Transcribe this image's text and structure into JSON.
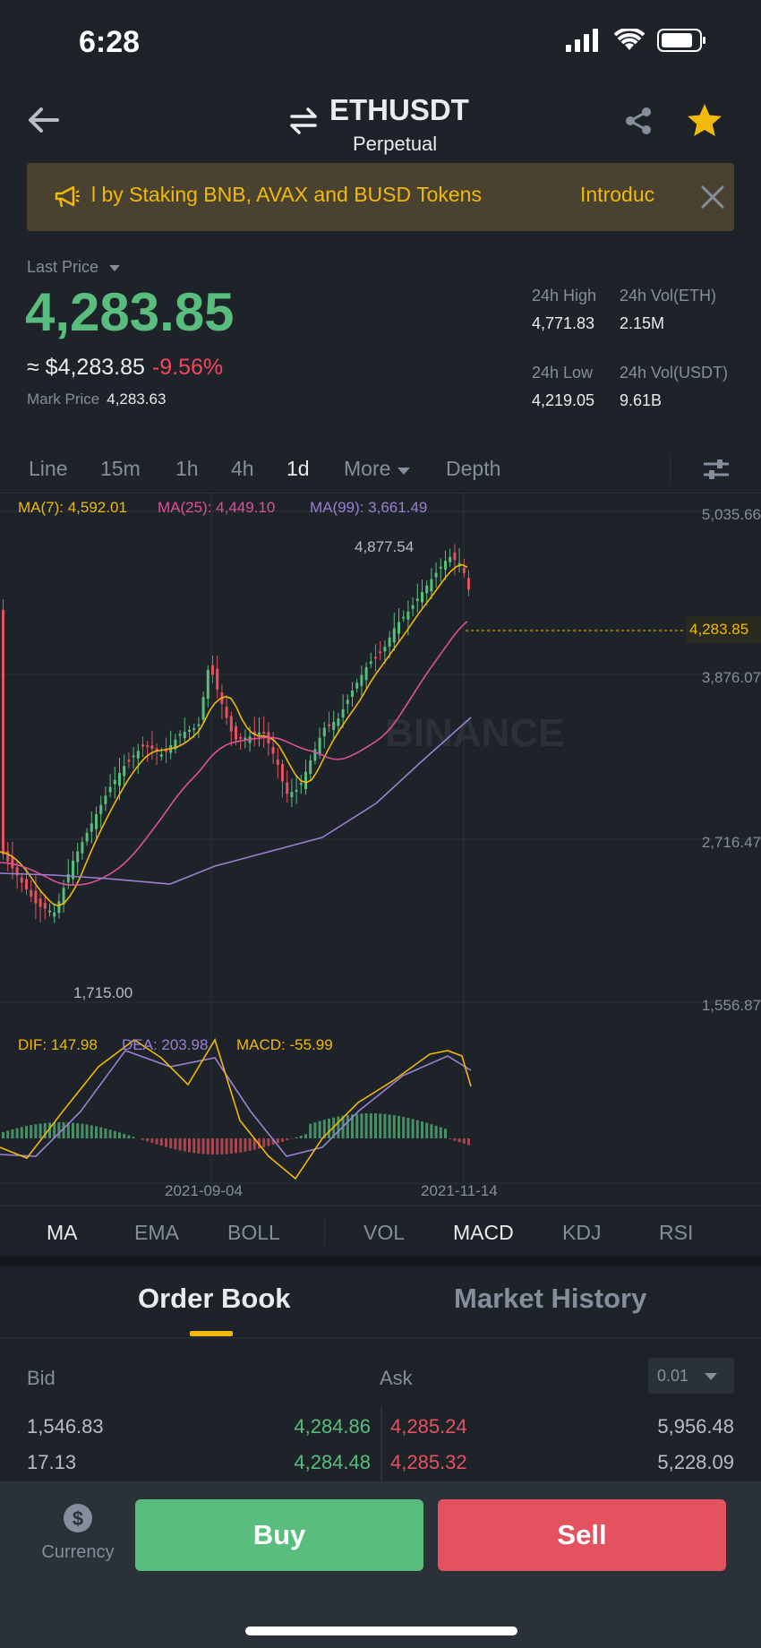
{
  "status_bar": {
    "time": "6:28"
  },
  "header": {
    "pair": "ETHUSDT",
    "contract_type": "Perpetual"
  },
  "banner": {
    "text": "l by Staking BNB, AVAX and BUSD Tokens",
    "link": "Introduc"
  },
  "ticker": {
    "last_price_label": "Last Price",
    "last_price": "4,283.85",
    "approx_usd": "≈ $4,283.85",
    "change_pct": "-9.56%",
    "mark_price_label": "Mark Price",
    "mark_price": "4,283.63",
    "high_label": "24h High",
    "high": "4,771.83",
    "vol_eth_label": "24h Vol(ETH)",
    "vol_eth": "2.15M",
    "low_label": "24h Low",
    "low": "4,219.05",
    "vol_usdt_label": "24h Vol(USDT)",
    "vol_usdt": "9.61B"
  },
  "intervals": [
    "Line",
    "15m",
    "1h",
    "4h",
    "1d",
    "More",
    "Depth"
  ],
  "active_interval": "1d",
  "chart": {
    "ma7_label": "MA(7): 4,592.01",
    "ma25_label": "MA(25): 4,449.10",
    "ma99_label": "MA(99): 3,661.49",
    "price_axis": [
      "5,035.66",
      "3,876.07",
      "2,716.47",
      "1,556.87"
    ],
    "current_price": "4,283.85",
    "high_marker": "4,877.54",
    "low_marker": "1,715.00",
    "watermark": "BINANCE",
    "dif_label": "DIF: 147.98",
    "dea_label": "DEA: 203.98",
    "macd_label": "MACD: -55.99",
    "dates": [
      "2021-09-04",
      "2021-11-14"
    ]
  },
  "indicator_tabs": [
    "MA",
    "EMA",
    "BOLL",
    "VOL",
    "MACD",
    "KDJ",
    "RSI"
  ],
  "order_book": {
    "tab_order_book": "Order Book",
    "tab_market_history": "Market History",
    "bid_label": "Bid",
    "ask_label": "Ask",
    "precision": "0.01",
    "rows": [
      {
        "bid_qty": "1,546.83",
        "bid_price": "4,284.86",
        "ask_price": "4,285.24",
        "ask_qty": "5,956.48"
      },
      {
        "bid_qty": "17.13",
        "bid_price": "4,284.48",
        "ask_price": "4,285.32",
        "ask_qty": "5,228.09"
      }
    ]
  },
  "bottom": {
    "currency_label": "Currency",
    "buy": "Buy",
    "sell": "Sell"
  },
  "colors": {
    "up": "#58bd7d",
    "down": "#e5525f",
    "accent": "#f0b90b",
    "bg": "#1e2329"
  }
}
